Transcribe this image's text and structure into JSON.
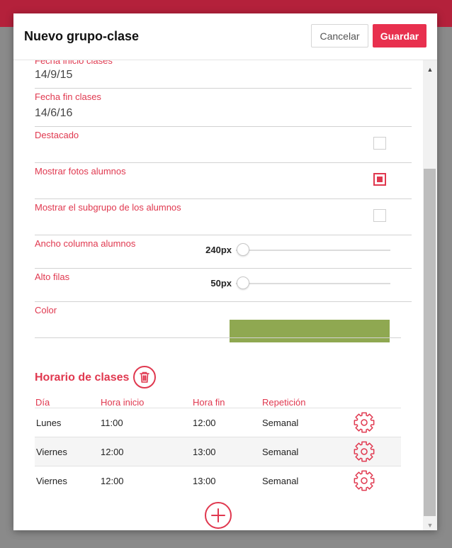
{
  "dialog": {
    "title": "Nuevo grupo-clase",
    "cancel_label": "Cancelar",
    "save_label": "Guardar"
  },
  "fields": {
    "start_date": {
      "label": "Fecha inicio clases",
      "value": "14/9/15"
    },
    "end_date": {
      "label": "Fecha fin clases",
      "value": "14/6/16"
    },
    "featured": {
      "label": "Destacado",
      "checked": false
    },
    "show_photos": {
      "label": "Mostrar fotos alumnos",
      "checked": true
    },
    "show_subgroup": {
      "label": "Mostrar el subgrupo de los alumnos",
      "checked": false
    },
    "column_width": {
      "label": "Ancho columna alumnos",
      "value": "240px"
    },
    "row_height": {
      "label": "Alto filas",
      "value": "50px"
    },
    "color": {
      "label": "Color",
      "value": "#8fa851"
    }
  },
  "schedule": {
    "title": "Horario de clases",
    "headers": {
      "day": "Día",
      "start": "Hora inicio",
      "end": "Hora fin",
      "repeat": "Repetición"
    },
    "rows": [
      {
        "day": "Lunes",
        "start": "11:00",
        "end": "12:00",
        "repeat": "Semanal"
      },
      {
        "day": "Viernes",
        "start": "12:00",
        "end": "13:00",
        "repeat": "Semanal"
      },
      {
        "day": "Viernes",
        "start": "12:00",
        "end": "13:00",
        "repeat": "Semanal"
      }
    ]
  },
  "colors": {
    "accent": "#e0384f",
    "topbar": "#b4213b"
  },
  "icons": {
    "delete": "trash-icon",
    "settings": "gear-icon",
    "add": "plus-icon"
  }
}
